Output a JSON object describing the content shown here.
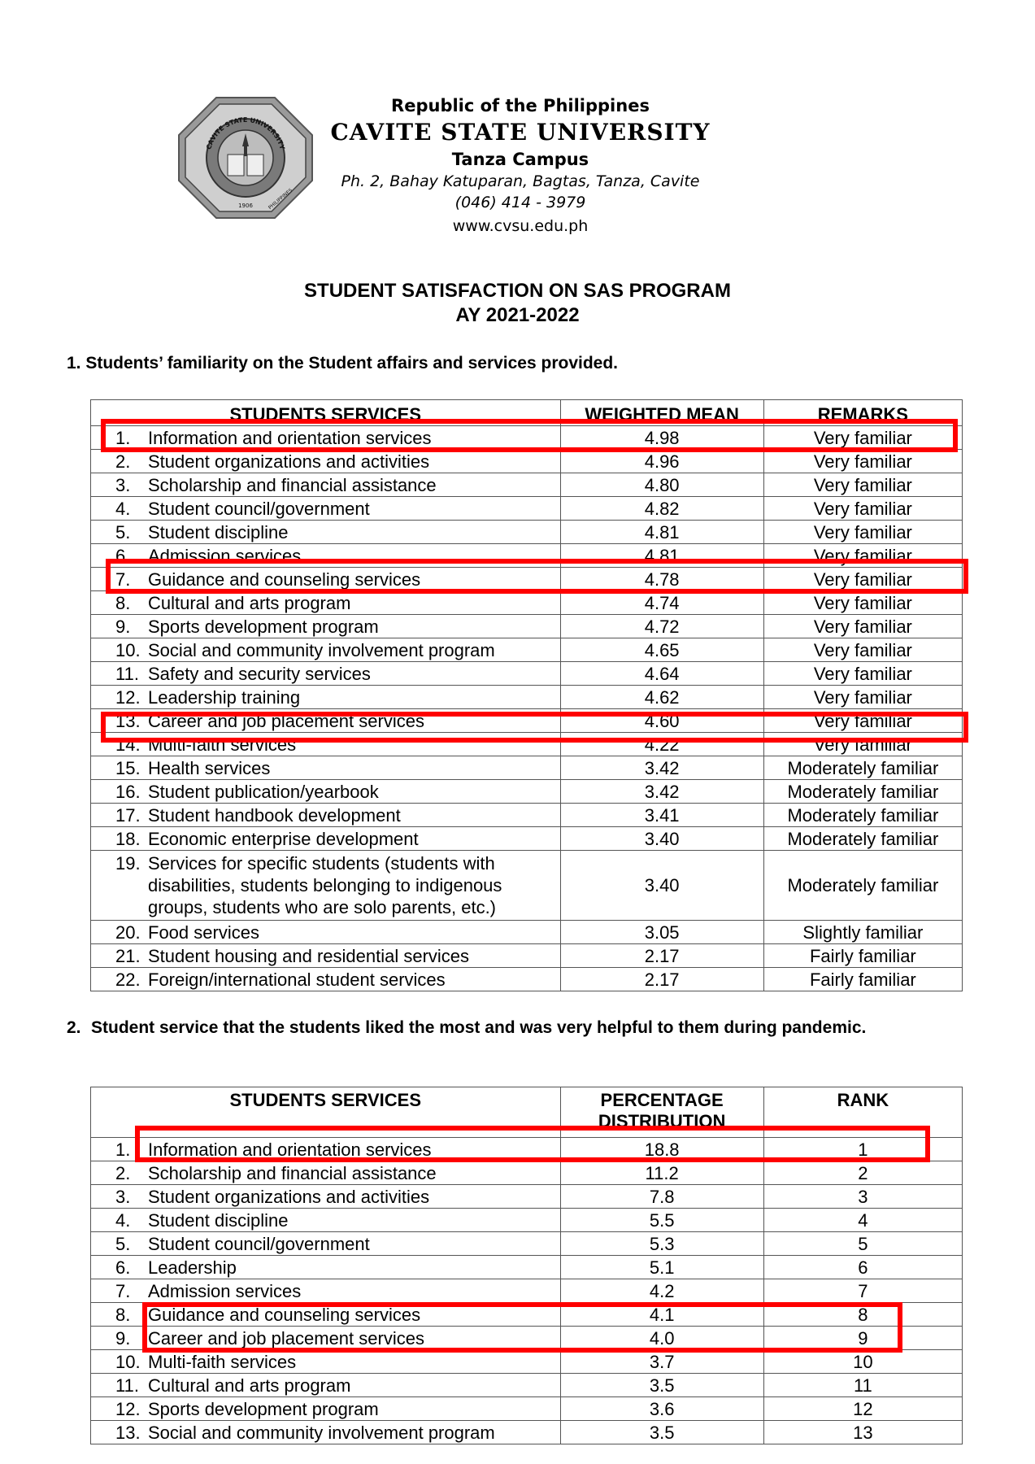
{
  "header": {
    "republic": "Republic of the Philippines",
    "university": "CAVITE STATE UNIVERSITY",
    "campus": "Tanza Campus",
    "address": "Ph. 2, Bahay Katuparan, Bagtas, Tanza, Cavite",
    "phone": "(046) 414 - 3979",
    "website": "www.cvsu.edu.ph"
  },
  "logo": {
    "name": "cavite-state-university-seal",
    "text_top": "CAVITE STATE UNIVERSITY",
    "year": "1906",
    "text_bottom": "PHILIPPINES"
  },
  "document": {
    "title": "STUDENT SATISFACTION ON SAS PROGRAM",
    "subtitle": "AY 2021-2022"
  },
  "section1": {
    "question": "1. Students’ familiarity on the Student affairs and services provided.",
    "headers": [
      "STUDENTS SERVICES",
      "WEIGHTED MEAN",
      "REMARKS"
    ],
    "rows": [
      {
        "num": "1.",
        "service": "Information and orientation services",
        "value": "4.98",
        "remark": "Very familiar"
      },
      {
        "num": "2.",
        "service": "Student organizations and activities",
        "value": "4.96",
        "remark": "Very familiar"
      },
      {
        "num": "3.",
        "service": "Scholarship and financial assistance",
        "value": "4.80",
        "remark": "Very familiar"
      },
      {
        "num": "4.",
        "service": "Student council/government",
        "value": "4.82",
        "remark": "Very familiar"
      },
      {
        "num": "5.",
        "service": "Student discipline",
        "value": "4.81",
        "remark": "Very familiar"
      },
      {
        "num": "6.",
        "service": "Admission services",
        "value": "4.81",
        "remark": "Very familiar"
      },
      {
        "num": "7.",
        "service": "Guidance and counseling services",
        "value": "4.78",
        "remark": "Very familiar"
      },
      {
        "num": "8.",
        "service": "Cultural and arts program",
        "value": "4.74",
        "remark": "Very familiar"
      },
      {
        "num": "9.",
        "service": "Sports development program",
        "value": "4.72",
        "remark": "Very familiar"
      },
      {
        "num": "10.",
        "service": "Social and community involvement program",
        "value": "4.65",
        "remark": "Very familiar"
      },
      {
        "num": "11.",
        "service": "Safety and security services",
        "value": "4.64",
        "remark": "Very familiar"
      },
      {
        "num": "12.",
        "service": "Leadership training",
        "value": "4.62",
        "remark": "Very familiar"
      },
      {
        "num": "13.",
        "service": "Career and job placement services",
        "value": "4.60",
        "remark": "Very familiar"
      },
      {
        "num": "14.",
        "service": "Multi-faith services",
        "value": "4.22",
        "remark": "Very familiar"
      },
      {
        "num": "15.",
        "service": "Health services",
        "value": "3.42",
        "remark": "Moderately familiar"
      },
      {
        "num": "16.",
        "service": "Student publication/yearbook",
        "value": "3.42",
        "remark": "Moderately familiar"
      },
      {
        "num": "17.",
        "service": "Student handbook development",
        "value": "3.41",
        "remark": "Moderately familiar"
      },
      {
        "num": "18.",
        "service": "Economic enterprise development",
        "value": "3.40",
        "remark": "Moderately familiar"
      },
      {
        "num": "19.",
        "service": "Services for specific students (students with disabilities, students belonging to indigenous groups, students who are solo parents, etc.)",
        "value": "3.40",
        "remark": "Moderately familiar"
      },
      {
        "num": "20.",
        "service": "Food services",
        "value": "3.05",
        "remark": "Slightly familiar"
      },
      {
        "num": "21.",
        "service": "Student housing and residential services",
        "value": "2.17",
        "remark": "Fairly familiar"
      },
      {
        "num": "22.",
        "service": "Foreign/international student services",
        "value": "2.17",
        "remark": "Fairly familiar"
      }
    ]
  },
  "section2": {
    "number": "2.",
    "question": "Student service that the students liked the most and was very helpful to them during pandemic.",
    "headers": [
      "STUDENTS SERVICES",
      "PERCENTAGE DISTRIBUTION",
      "RANK"
    ],
    "rows": [
      {
        "num": "1.",
        "service": "Information and orientation services",
        "value": "18.8",
        "rank": "1"
      },
      {
        "num": "2.",
        "service": "Scholarship and financial assistance",
        "value": "11.2",
        "rank": "2"
      },
      {
        "num": "3.",
        "service": "Student organizations and activities",
        "value": "7.8",
        "rank": "3"
      },
      {
        "num": "4.",
        "service": "Student discipline",
        "value": "5.5",
        "rank": "4"
      },
      {
        "num": "5.",
        "service": "Student council/government",
        "value": "5.3",
        "rank": "5"
      },
      {
        "num": "6.",
        "service": "Leadership",
        "value": "5.1",
        "rank": "6"
      },
      {
        "num": "7.",
        "service": "Admission services",
        "value": "4.2",
        "rank": "7"
      },
      {
        "num": "8.",
        "service": "Guidance and counseling services",
        "value": "4.1",
        "rank": "8"
      },
      {
        "num": "9.",
        "service": "Career and job placement services",
        "value": "4.0",
        "rank": "9"
      },
      {
        "num": "10.",
        "service": "Multi-faith services",
        "value": "3.7",
        "rank": "10"
      },
      {
        "num": "11.",
        "service": "Cultural and arts program",
        "value": "3.5",
        "rank": "11"
      },
      {
        "num": "12.",
        "service": "Sports development program",
        "value": "3.6",
        "rank": "12"
      },
      {
        "num": "13.",
        "service": "Social and community involvement program",
        "value": "3.5",
        "rank": "13"
      }
    ]
  },
  "highlight_color": "#ff0000"
}
